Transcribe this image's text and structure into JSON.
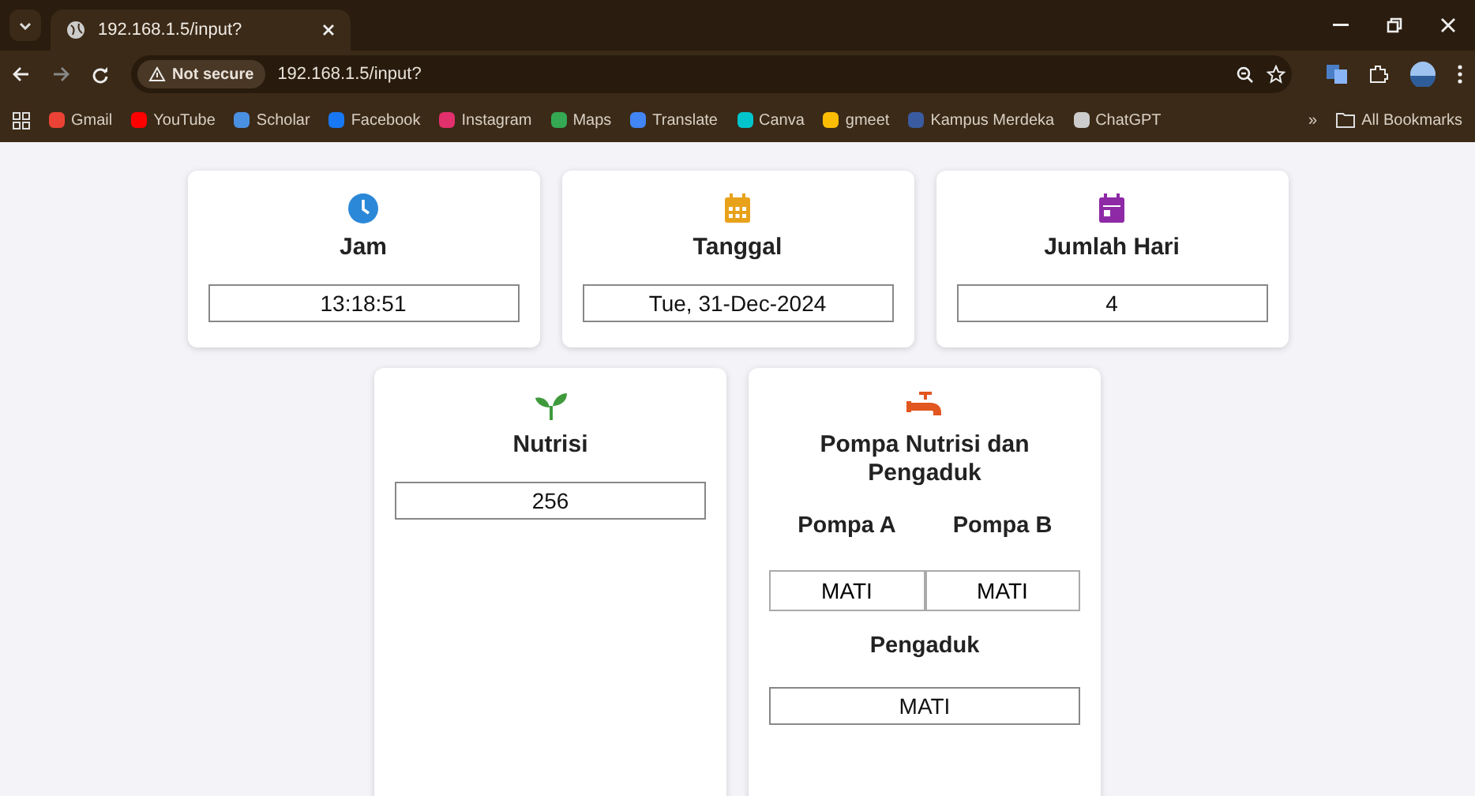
{
  "browser": {
    "tab": {
      "title": "192.168.1.5/input?",
      "selected": true
    },
    "security": "Not secure",
    "url": "192.168.1.5/input?",
    "bookmarks": [
      "Gmail",
      "YouTube",
      "Scholar",
      "Facebook",
      "Instagram",
      "Maps",
      "Translate",
      "Canva",
      "gmeet",
      "Kampus Merdeka",
      "ChatGPT"
    ],
    "more": "»",
    "all_bookmarks": "All Bookmarks"
  },
  "cards": [
    {
      "kind": "single",
      "title": "Jam",
      "value": "13:18:51"
    },
    {
      "kind": "single",
      "title": "Tanggal",
      "value": "Tue, 31-Dec-2024"
    },
    {
      "kind": "single",
      "title": "Jumlah Hari",
      "value": "4"
    },
    {
      "kind": "single",
      "title": "Nutrisi",
      "value": "256"
    },
    {
      "kind": "pump",
      "title": "Pompa Nutrisi dan Pengaduk",
      "pumps": [
        {
          "label": "Pompa A",
          "value": "MATI"
        },
        {
          "label": "Pompa B",
          "value": "MATI"
        }
      ],
      "mixer": {
        "label": "Pengaduk",
        "value": "MATI"
      }
    }
  ]
}
